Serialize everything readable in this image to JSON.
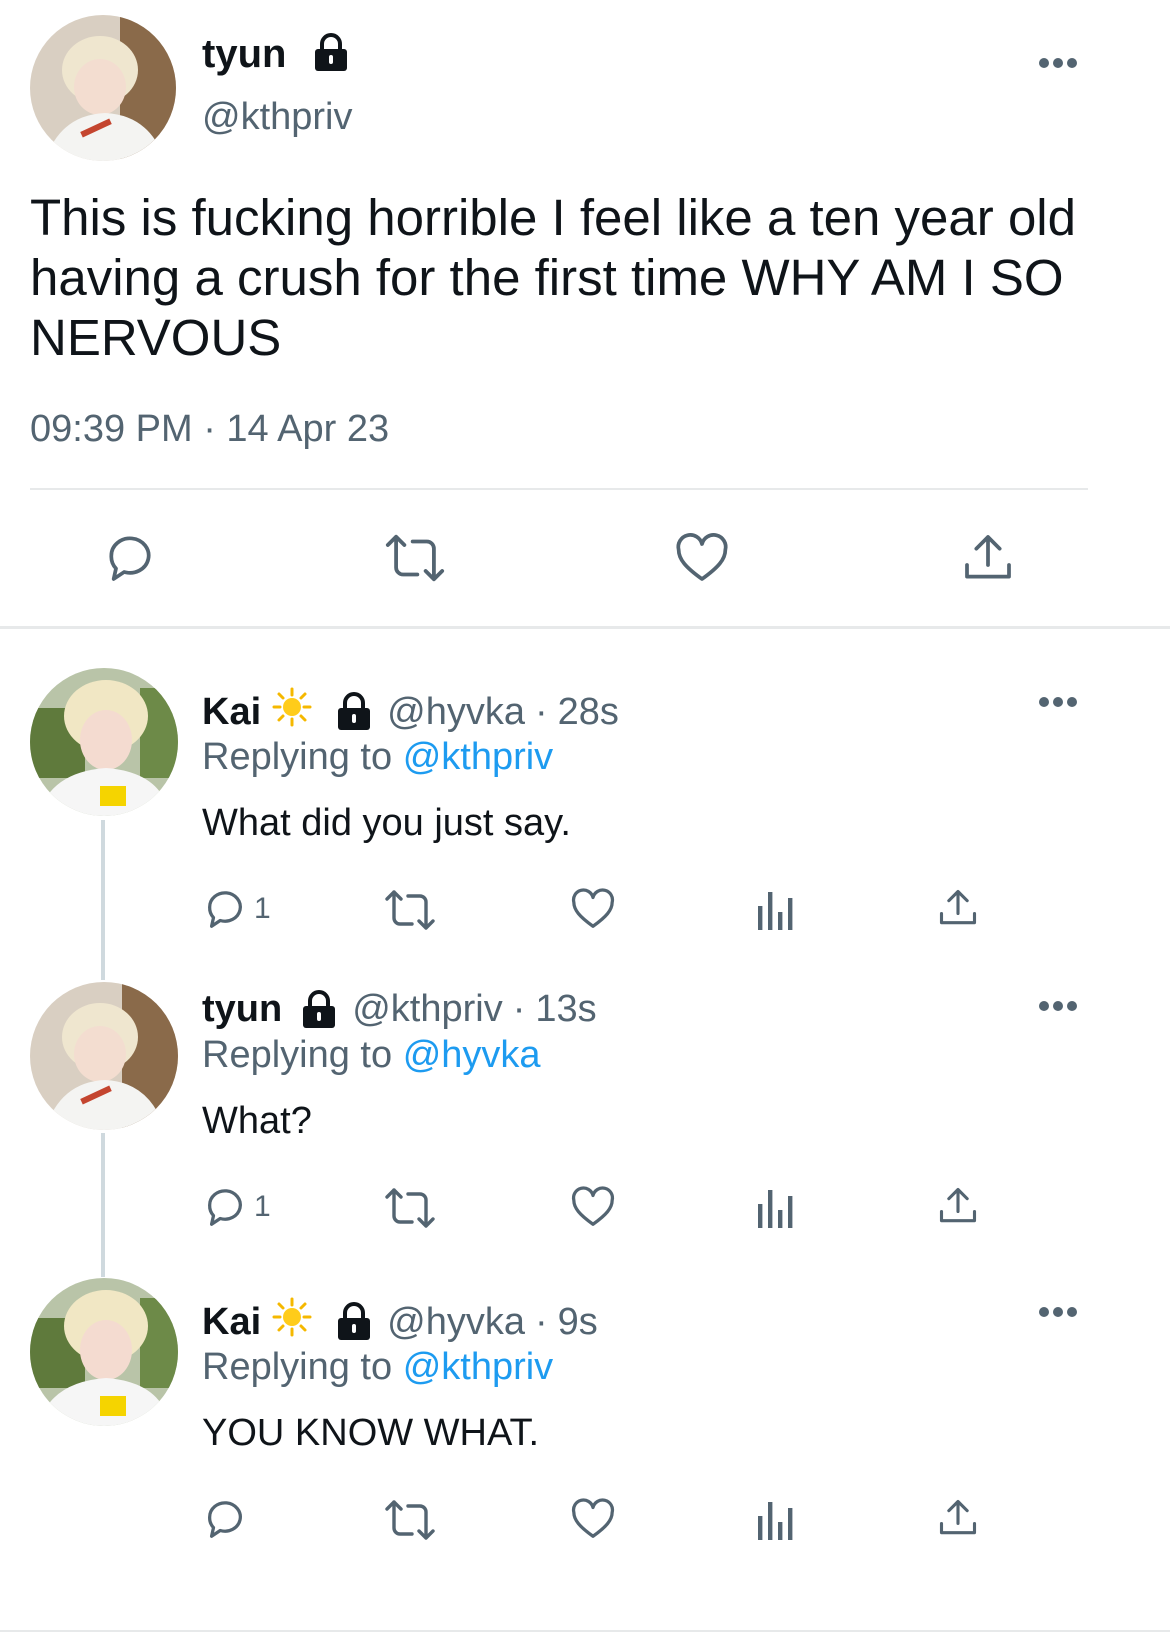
{
  "main_tweet": {
    "name": "tyun",
    "handle": "@kthpriv",
    "text": "This is fucking horrible I feel like a ten year old having a crush for the first time WHY AM I SO NERVOUS",
    "timestamp": "09:39 PM · 14 Apr 23",
    "actions": [
      "reply-icon",
      "retweet-icon",
      "like-icon",
      "share-icon"
    ]
  },
  "replies": [
    {
      "name": "Kai",
      "emoji": "sun-icon",
      "handle": "@hyvka",
      "separator": "·",
      "time": "28s",
      "replying_prefix": "Replying to",
      "replying_handle": "@kthpriv",
      "text": "What did you just say.",
      "reply_count": "1"
    },
    {
      "name": "tyun",
      "handle": "@kthpriv",
      "separator": "·",
      "time": "13s",
      "replying_prefix": "Replying to",
      "replying_handle": "@hyvka",
      "text": "What?",
      "reply_count": "1"
    },
    {
      "name": "Kai",
      "emoji": "sun-icon",
      "handle": "@hyvka",
      "separator": "·",
      "time": "9s",
      "replying_prefix": "Replying to",
      "replying_handle": "@kthpriv",
      "text": "YOU KNOW WHAT.",
      "reply_count": ""
    }
  ],
  "colors": {
    "text": "#0f1419",
    "secondary": "#536471",
    "link": "#1d9bf0",
    "divider": "#e7e9ea"
  }
}
